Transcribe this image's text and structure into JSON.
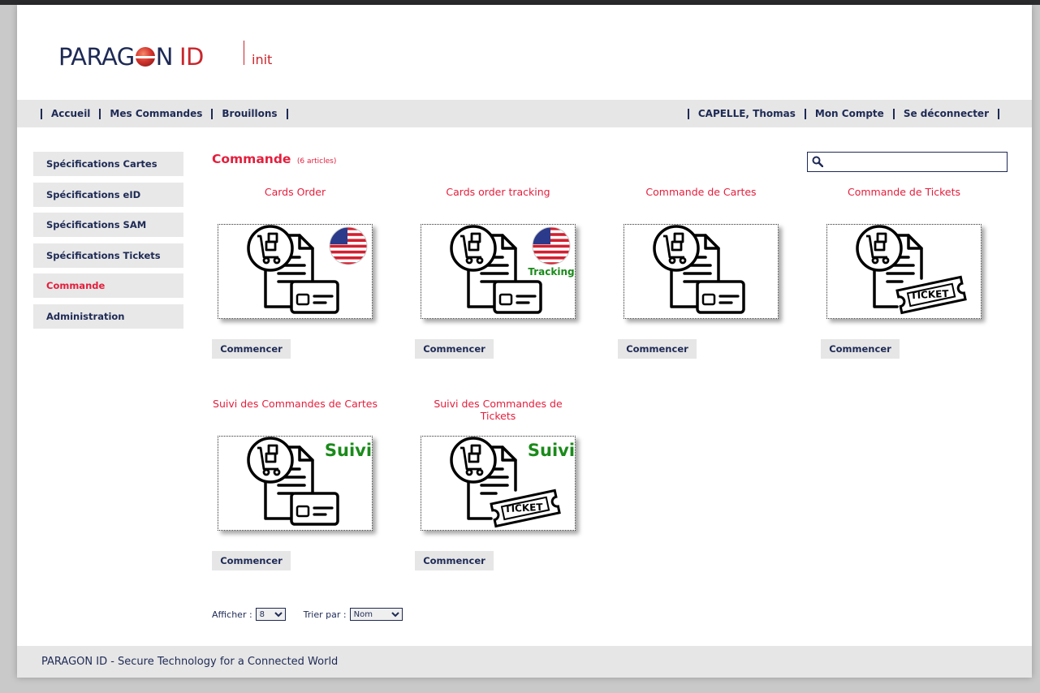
{
  "header": {
    "logo_main": "PARAG",
    "logo_after_ball": "N",
    "logo_id": "ID",
    "logo_sub": "init"
  },
  "nav": {
    "left": [
      "Accueil",
      "Mes Commandes",
      "Brouillons"
    ],
    "right": [
      "CAPELLE, Thomas",
      "Mon Compte",
      "Se déconnecter"
    ]
  },
  "sidebar": {
    "items": [
      {
        "label": "Spécifications Cartes",
        "active": false
      },
      {
        "label": "Spécifications eID",
        "active": false
      },
      {
        "label": "Spécifications SAM",
        "active": false
      },
      {
        "label": "Spécifications Tickets",
        "active": false
      },
      {
        "label": "Commande",
        "active": true
      },
      {
        "label": "Administration",
        "active": false
      }
    ]
  },
  "main": {
    "title": "Commande",
    "count": "(6 articles)",
    "search_value": "",
    "cards": [
      {
        "title": "Cards Order",
        "button": "Commencer",
        "icon": "order-card-us-flag-icon"
      },
      {
        "title": "Cards order tracking",
        "button": "Commencer",
        "icon": "order-card-us-flag-tracking-icon",
        "badge": "Tracking"
      },
      {
        "title": "Commande de Cartes",
        "button": "Commencer",
        "icon": "order-card-icon"
      },
      {
        "title": "Commande de Tickets",
        "button": "Commencer",
        "icon": "order-ticket-icon",
        "ticket_text": "TICKET"
      },
      {
        "title": "Suivi des Commandes de Cartes",
        "button": "Commencer",
        "icon": "order-card-suivi-icon",
        "badge": "Suivi"
      },
      {
        "title": "Suivi des Commandes de Tickets",
        "button": "Commencer",
        "icon": "order-ticket-suivi-icon",
        "badge": "Suivi",
        "ticket_text": "TICKET"
      }
    ]
  },
  "pager": {
    "show_label": "Afficher :",
    "show_value": "8",
    "sort_label": "Trier par :",
    "sort_value": "Nom"
  },
  "footer": {
    "text": "PARAGON ID - Secure Technology for a Connected World"
  },
  "colors": {
    "accent": "#e41e3c",
    "navy": "#1e2a55",
    "gray_bar": "#e6e6e6",
    "green_badge": "#1a8a1a"
  }
}
